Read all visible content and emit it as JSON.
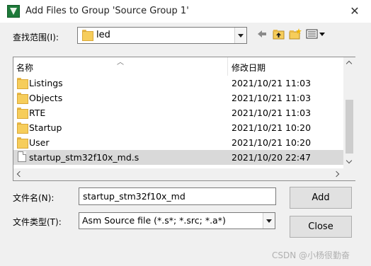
{
  "window": {
    "title": "Add Files to Group 'Source Group 1'",
    "close_glyph": "✕"
  },
  "lookin": {
    "label": "查找范围(I):",
    "value": "led"
  },
  "list": {
    "columns": {
      "name": "名称",
      "date": "修改日期"
    },
    "items": [
      {
        "name": "Listings",
        "date": "2021/10/21 11:03",
        "type": "folder"
      },
      {
        "name": "Objects",
        "date": "2021/10/21 11:03",
        "type": "folder"
      },
      {
        "name": "RTE",
        "date": "2021/10/21 11:03",
        "type": "folder"
      },
      {
        "name": "Startup",
        "date": "2021/10/21 10:20",
        "type": "folder"
      },
      {
        "name": "User",
        "date": "2021/10/21 10:20",
        "type": "folder"
      },
      {
        "name": "startup_stm32f10x_md.s",
        "date": "2021/10/20 22:47",
        "type": "file"
      }
    ]
  },
  "filename": {
    "label": "文件名(N):",
    "value": "startup_stm32f10x_md"
  },
  "filetype": {
    "label": "文件类型(T):",
    "value": "Asm Source file (*.s*; *.src; *.a*)"
  },
  "buttons": {
    "add": "Add",
    "close": "Close"
  },
  "watermark": "CSDN @小杨很勤奋",
  "colors": {
    "selected_row": "#d9d9d9",
    "folder": "#f6cd5b",
    "app_icon": "#1e7a3a"
  }
}
